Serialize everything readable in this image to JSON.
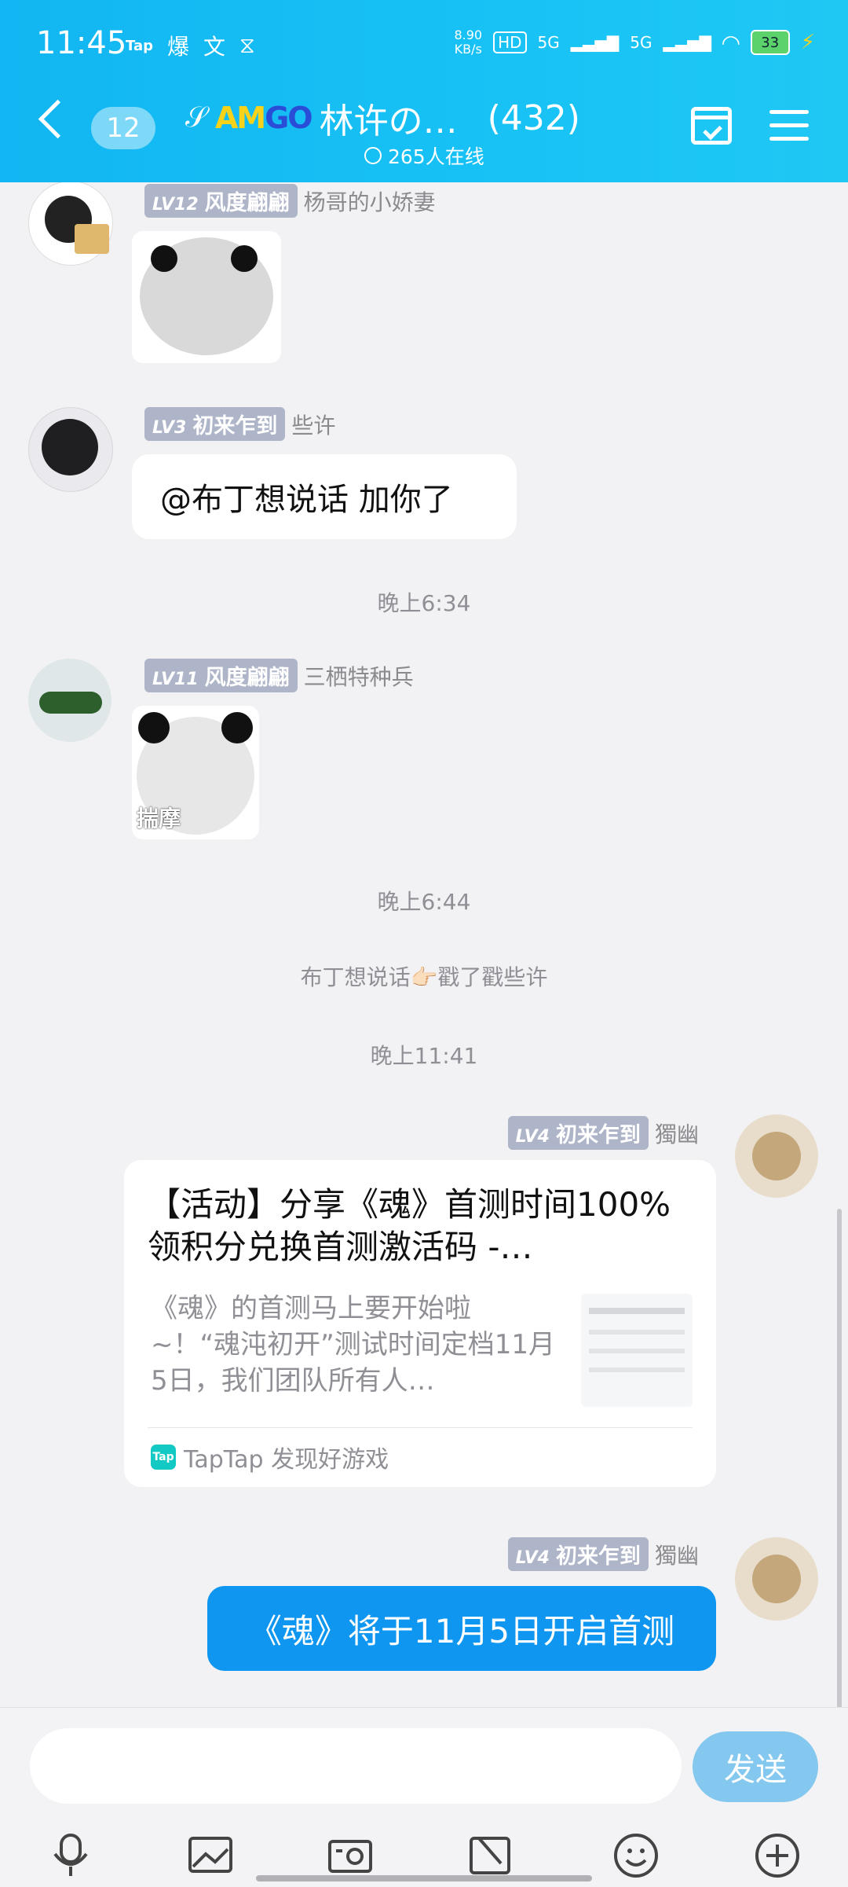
{
  "status_bar": {
    "time": "11:45",
    "left_icons": [
      "tap-icon",
      "爆",
      "文",
      "hourglass-icon"
    ],
    "net_speed_value": "8.90",
    "net_speed_unit": "KB/s",
    "signal_1": "5G",
    "signal_2": "5G",
    "battery": "33"
  },
  "header": {
    "unread_count": "12",
    "group_brand": "AMGO",
    "group_name": "林许の…",
    "member_count": "(432)",
    "online_text": "265人在线"
  },
  "messages": [
    {
      "level": "LV12",
      "title": "风度翩翩",
      "name": "杨哥的小娇妻",
      "type": "sticker"
    },
    {
      "level": "LV3",
      "title": "初来乍到",
      "name": "些许",
      "text": "@布丁想说话 加你了"
    },
    {
      "time": "晚上6:34"
    },
    {
      "level": "LV11",
      "title": "风度翩翩",
      "name": "三栖特种兵",
      "type": "sticker",
      "sticker_caption": "揣摩"
    },
    {
      "time": "晚上6:44"
    },
    {
      "notice": "布丁想说话👉🏻戳了戳些许"
    },
    {
      "time": "晚上11:41"
    },
    {
      "level": "LV4",
      "title": "初来乍到",
      "name": "獨幽",
      "card": {
        "title": "【活动】分享《魂》首测时间100%领积分兑换首测激活码 -…",
        "desc": "《魂》的首测马上要开始啦~！“魂沌初开”测试时间定档11月5日，我们团队所有人…",
        "source": "TapTap 发现好游戏",
        "logo": "Tap"
      }
    },
    {
      "level": "LV4",
      "title": "初来乍到",
      "name": "獨幽",
      "text": "《魂》将于11月5日开启首测"
    }
  ],
  "footer": {
    "send_label": "发送",
    "icons": [
      "microphone-icon",
      "image-icon",
      "camera-icon",
      "folder-icon",
      "emoji-icon",
      "plus-icon"
    ]
  },
  "colors": {
    "header": "#18c2f5",
    "bubble_blue": "#0f96f0",
    "badge": "#aeb5c8",
    "send_button": "#85c8ef"
  }
}
